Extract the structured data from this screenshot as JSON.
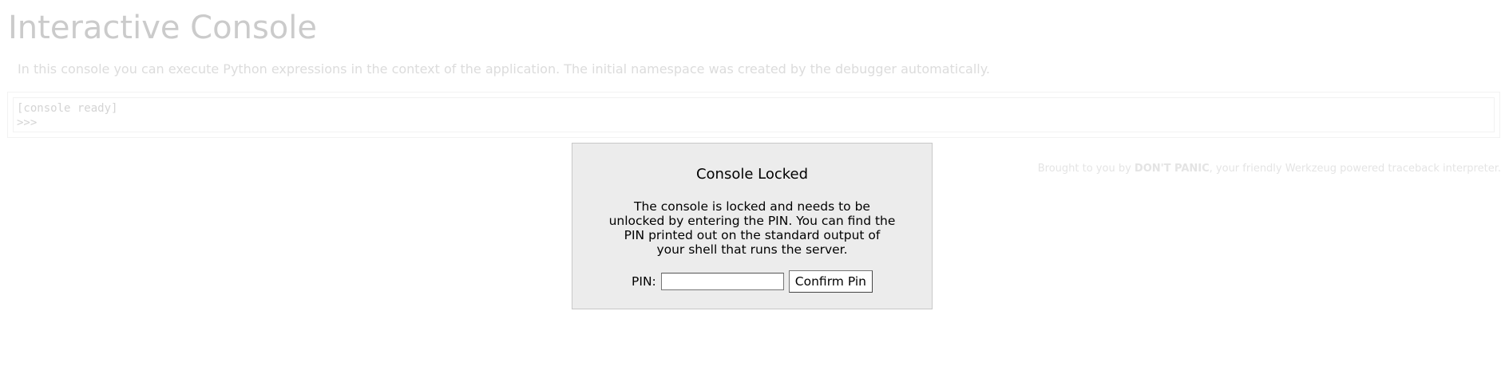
{
  "page": {
    "title": "Interactive Console",
    "explanation": "In this console you can execute Python expressions in the context of the application. The initial namespace was created by the debugger automatically."
  },
  "console": {
    "lines": [
      "[console ready]",
      ">>>"
    ]
  },
  "footer": {
    "prefix": "Brought to you by ",
    "brand": "DON'T PANIC",
    "suffix": ", your friendly Werkzeug powered traceback interpreter."
  },
  "pin_dialog": {
    "title": "Console Locked",
    "text": "The console is locked and needs to be unlocked by entering the PIN. You can find the PIN printed out on the standard output of your shell that runs the server.",
    "pin_label": "PIN:",
    "pin_value": "",
    "pin_placeholder": "",
    "confirm_label": "Confirm Pin"
  },
  "colors": {
    "dialog_background": "#ececec",
    "dimmed_text": "#cbcbcb"
  }
}
